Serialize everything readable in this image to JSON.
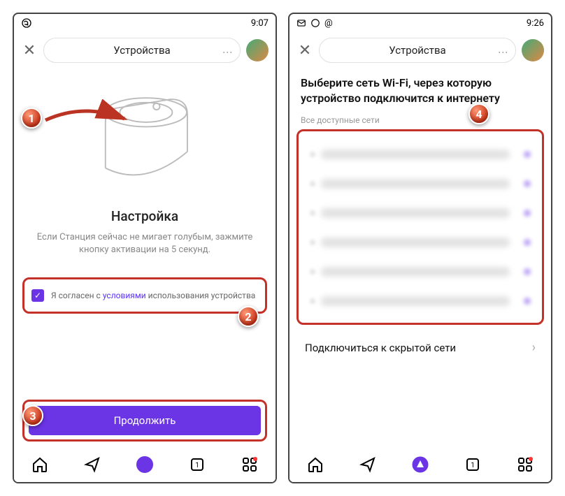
{
  "left": {
    "status": {
      "time": "9:07"
    },
    "header": {
      "title": "Устройства"
    },
    "setup": {
      "title": "Настройка",
      "subtitle": "Если Станция сейчас не мигает голубым, зажмите кнопку активации на 5 секунд."
    },
    "consent": {
      "prefix": "Я согласен с ",
      "link": "условиями",
      "suffix": " использования устройства"
    },
    "continue_label": "Продолжить"
  },
  "right": {
    "status": {
      "time": "9:26"
    },
    "header": {
      "title": "Устройства"
    },
    "wifi": {
      "title": "Выберите сеть Wi-Fi, через которую устройство подключится к интернету",
      "subtitle": "Все доступные сети",
      "hidden_label": "Подключиться к скрытой сети"
    }
  },
  "markers": {
    "m1": "1",
    "m2": "2",
    "m3": "3",
    "m4": "4"
  }
}
